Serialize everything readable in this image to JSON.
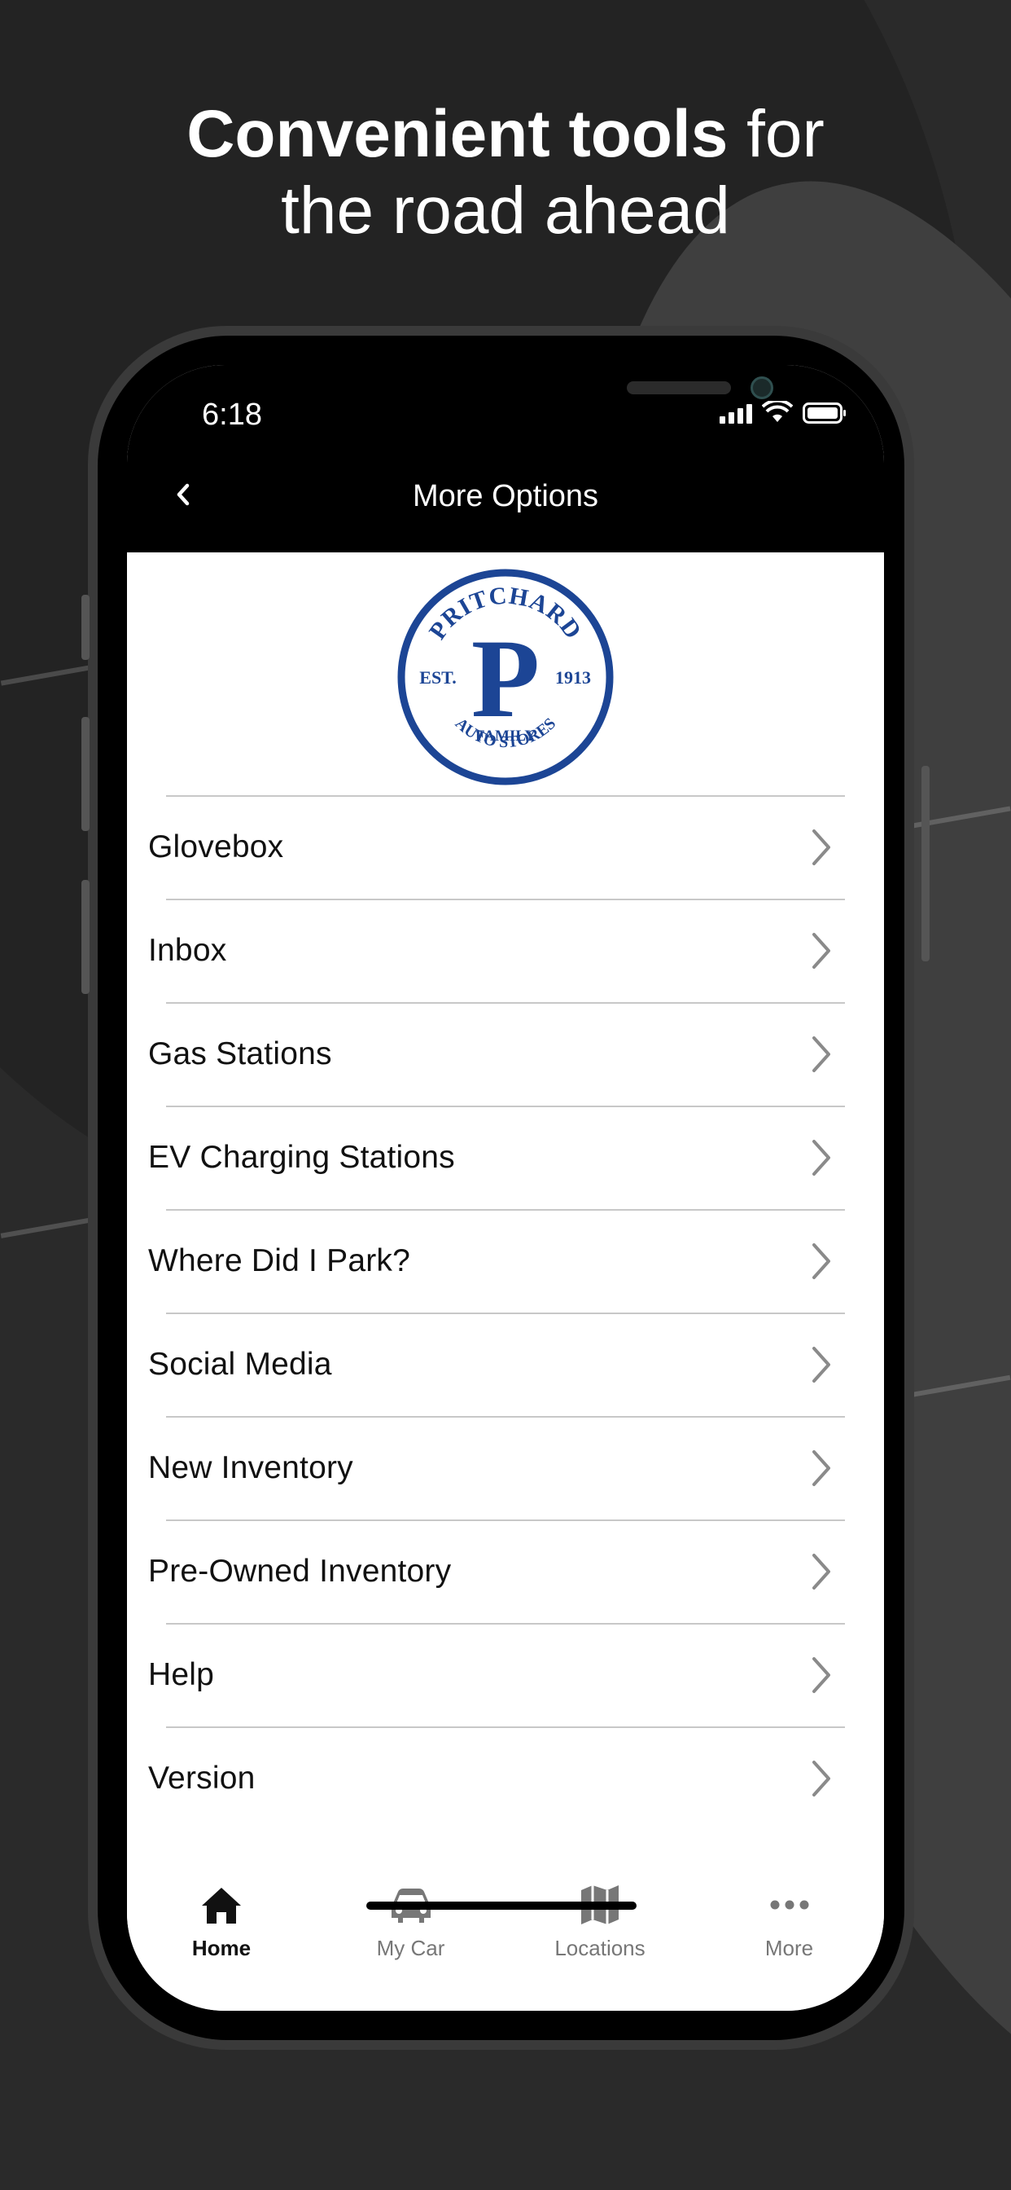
{
  "headline": {
    "bold": "Convenient tools",
    "rest_line1": " for",
    "line2": "the road ahead"
  },
  "status_bar": {
    "time": "6:18"
  },
  "nav": {
    "title": "More Options",
    "back_icon": "chevron-left-icon"
  },
  "logo": {
    "text_top": "PRITCHARD",
    "letter": "P",
    "left": "EST.",
    "right": "1913",
    "bottom1": "FAMILY",
    "bottom2": "AUTO STORES",
    "color": "#1c4595"
  },
  "menu": {
    "items": [
      {
        "label": "Glovebox"
      },
      {
        "label": "Inbox"
      },
      {
        "label": "Gas Stations"
      },
      {
        "label": "EV Charging Stations"
      },
      {
        "label": "Where Did I Park?"
      },
      {
        "label": "Social Media"
      },
      {
        "label": "New Inventory"
      },
      {
        "label": "Pre-Owned Inventory"
      },
      {
        "label": "Help"
      },
      {
        "label": "Version"
      }
    ]
  },
  "tabs": [
    {
      "label": "Home",
      "icon": "home-icon",
      "active": true
    },
    {
      "label": "My Car",
      "icon": "car-icon",
      "active": false
    },
    {
      "label": "Locations",
      "icon": "map-icon",
      "active": false
    },
    {
      "label": "More",
      "icon": "more-icon",
      "active": false
    }
  ],
  "colors": {
    "accent": "#1c4595",
    "chevron": "#8a8a8a",
    "divider": "#c8c8c8"
  }
}
